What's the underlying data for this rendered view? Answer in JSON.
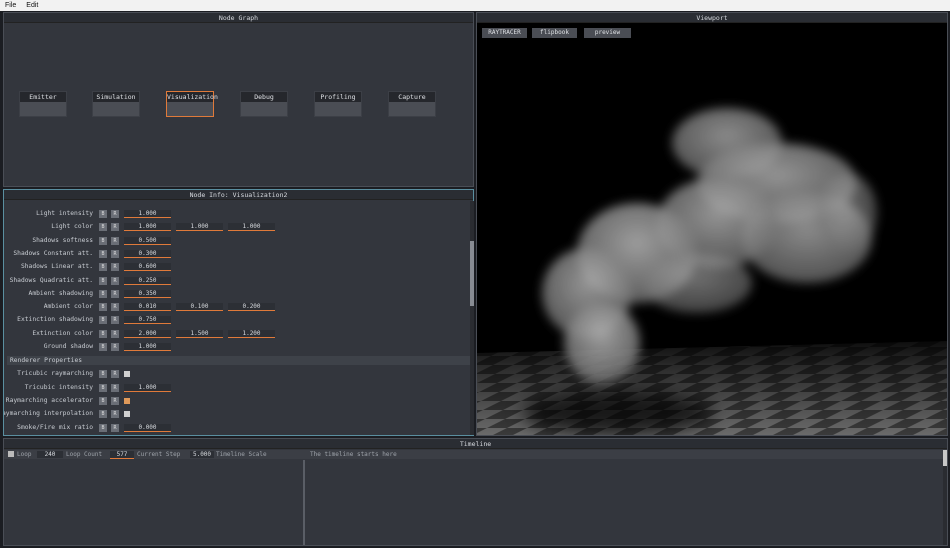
{
  "menu": {
    "file": "File",
    "edit": "Edit"
  },
  "node_graph": {
    "title": "Node Graph",
    "nodes": [
      "Emitter",
      "Simulation",
      "Visualization",
      "Debug",
      "Profiling",
      "Capture"
    ],
    "selected": "Visualization"
  },
  "node_info": {
    "title": "Node Info: Visualization2",
    "button_b": "B",
    "button_r": "R",
    "rows": [
      {
        "label": "Light intensity",
        "values": [
          "1.000"
        ]
      },
      {
        "label": "Light color",
        "values": [
          "1.000",
          "1.000",
          "1.000"
        ]
      },
      {
        "label": "Shadows softness",
        "values": [
          "0.500"
        ]
      },
      {
        "label": "Shadows Constant att.",
        "values": [
          "0.300"
        ]
      },
      {
        "label": "Shadows Linear att.",
        "values": [
          "0.600"
        ]
      },
      {
        "label": "Shadows Quadratic att.",
        "values": [
          "0.250"
        ]
      },
      {
        "label": "Ambient shadowing",
        "values": [
          "0.350"
        ]
      },
      {
        "label": "Ambient color",
        "values": [
          "0.010",
          "0.100",
          "0.200"
        ]
      },
      {
        "label": "Extinction shadowing",
        "values": [
          "0.750"
        ]
      },
      {
        "label": "Extinction color",
        "values": [
          "2.000",
          "1.500",
          "1.200"
        ]
      },
      {
        "label": "Ground shadow",
        "values": [
          "1.000"
        ]
      }
    ],
    "renderer_section": "Renderer Properties",
    "renderer_rows": [
      {
        "label": "Tricubic raymarching",
        "checkbox": false
      },
      {
        "label": "Tricubic intensity",
        "values": [
          "1.000"
        ]
      },
      {
        "label": "Raymarching accelerator",
        "checkbox": true
      },
      {
        "label": "Raymarching interpolation",
        "checkbox": false
      },
      {
        "label": "Smoke/Fire mix ratio",
        "values": [
          "0.000"
        ]
      }
    ]
  },
  "viewport": {
    "title": "Viewport",
    "buttons": [
      "RAYTRACER",
      "flipbook",
      "preview"
    ]
  },
  "timeline": {
    "title": "Timeline",
    "loop_label": "Loop",
    "loop_value": "240",
    "loop_count_label": "Loop Count",
    "loop_count_value": "577",
    "current_step_label": "Current Step",
    "scale_value": "5.000",
    "scale_label": "Timeline Scale",
    "start_text": "The timeline starts here"
  },
  "colors": {
    "accent": "#e07a3a",
    "panel": "#33363d",
    "viewport_bg": "#000000"
  }
}
